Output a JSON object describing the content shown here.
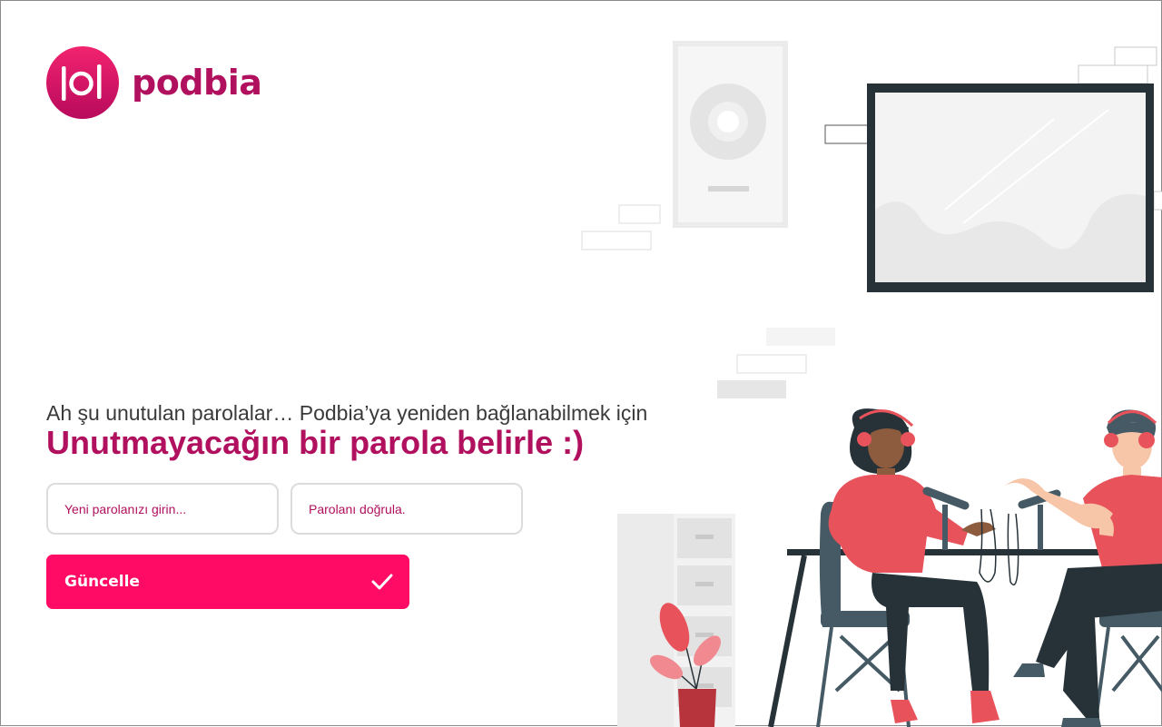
{
  "brand": {
    "name": "podbia",
    "color": "#b0105e",
    "accent": "#ff0a64"
  },
  "intro": {
    "subtitle": "Ah şu unutulan parolalar… Podbia’ya yeniden bağlanabilmek için",
    "title": "Unutmayacağın bir parola belirle :)"
  },
  "form": {
    "new_password": {
      "placeholder": "Yeni parolanızı girin...",
      "value": ""
    },
    "confirm_password": {
      "placeholder": "Parolanı doğrula.",
      "value": ""
    },
    "submit_label": "Güncelle",
    "submit_icon": "check-icon"
  },
  "illustration": {
    "name": "podcast-recording-illustration"
  }
}
